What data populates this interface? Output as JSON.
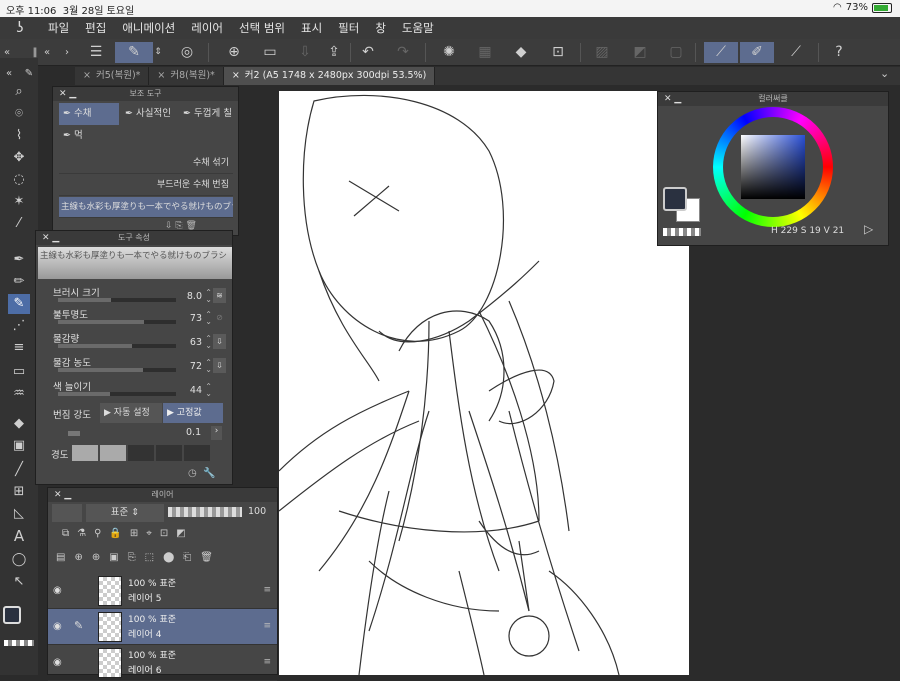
{
  "status": {
    "time": "오후 11:06",
    "date": "3월 28일 토요일",
    "battery": "73%"
  },
  "menu": [
    "파일",
    "편집",
    "애니메이션",
    "레이어",
    "선택 범위",
    "표시",
    "필터",
    "창",
    "도움말"
  ],
  "tabs": [
    {
      "label": "커5(복원)*"
    },
    {
      "label": "커8(복원)*"
    },
    {
      "label": "커2 (A5 1748 x 2480px 300dpi 53.5%)"
    }
  ],
  "subtool": {
    "title": "보조 도구",
    "tabs": [
      "수채",
      "사실적인",
      "두껍게 칠",
      "먹"
    ],
    "brushes": [
      "수채 섞기",
      "부드러운 수채 번짐",
      "主線も水彩も厚塗りも一本でやる就けものブラシ"
    ]
  },
  "toolprop": {
    "title": "도구 속성",
    "brush_name": "主線も水彩も厚塗りも一本でやる就けものブラシ",
    "rows": [
      {
        "label": "브러시 크기",
        "value": "8.0",
        "level": 0.45
      },
      {
        "label": "불투명도",
        "value": "73",
        "level": 0.73
      },
      {
        "label": "물감량",
        "value": "63",
        "level": 0.63
      },
      {
        "label": "물감 농도",
        "value": "72",
        "level": 0.72
      },
      {
        "label": "색 늘이기",
        "value": "44",
        "level": 0.44
      }
    ],
    "blur_label": "번짐 강도",
    "auto_label": "자동 설정",
    "fixed_label": "고정값",
    "blur_value": "0.1",
    "hardness_label": "경도"
  },
  "layers": {
    "title": "레이어",
    "blend": "표준",
    "opacity": "100",
    "items": [
      {
        "pct": "100 % 표준",
        "name": "레이어 5",
        "selected": false
      },
      {
        "pct": "100 % 표준",
        "name": "레이어 4",
        "selected": true
      },
      {
        "pct": "100 % 표준",
        "name": "레이어 6",
        "selected": false
      }
    ]
  },
  "color": {
    "title": "컬러써클",
    "h_label": "H",
    "h": "229",
    "s_label": "S",
    "s": "19",
    "v_label": "V",
    "v": "21",
    "main_color": "#2a3140",
    "sub_color": "#ffffff"
  }
}
